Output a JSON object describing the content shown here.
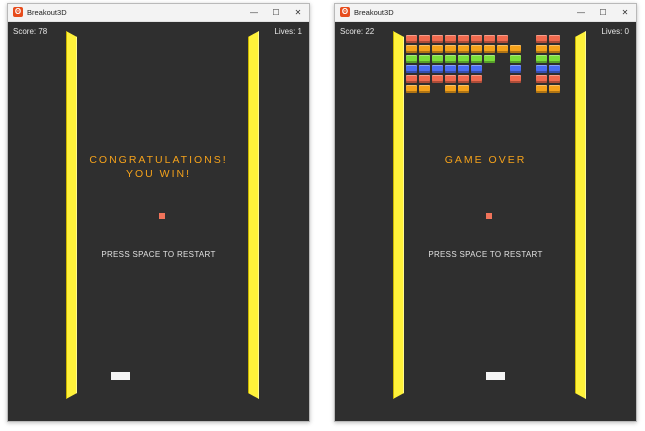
{
  "colors": {
    "wall": "#fff23a",
    "message": "#f5a21b",
    "ball": "#f0735a",
    "paddle": "#f5f5f5",
    "background": "#2f2f2f",
    "brick_rows": [
      "#f06a4e",
      "#f5a21b",
      "#7be03a",
      "#4a6df2",
      "#f06a4e",
      "#f5a21b"
    ]
  },
  "windows": [
    {
      "title": "Breakout3D",
      "score_label": "Score:",
      "score": "78",
      "lives_label": "Lives:",
      "lives": "1",
      "message_line1": "CONGRATULATIONS!",
      "message_line2": "YOU WIN!",
      "restart_text": "PRESS SPACE TO RESTART"
    },
    {
      "title": "Breakout3D",
      "score_label": "Score:",
      "score": "22",
      "lives_label": "Lives:",
      "lives": "0",
      "message_line1": "GAME OVER",
      "message_line2": "",
      "restart_text": "PRESS SPACE TO RESTART",
      "bricks": [
        [
          1,
          1,
          1,
          1,
          1,
          1,
          1,
          1,
          0,
          0,
          1,
          1
        ],
        [
          1,
          1,
          1,
          1,
          1,
          1,
          1,
          1,
          1,
          0,
          1,
          1
        ],
        [
          1,
          1,
          1,
          1,
          1,
          1,
          1,
          0,
          1,
          0,
          1,
          1
        ],
        [
          1,
          1,
          1,
          1,
          1,
          1,
          0,
          0,
          1,
          0,
          1,
          1
        ],
        [
          1,
          1,
          1,
          1,
          1,
          1,
          0,
          0,
          1,
          0,
          1,
          1
        ],
        [
          1,
          1,
          0,
          1,
          1,
          0,
          0,
          0,
          0,
          0,
          1,
          1
        ]
      ]
    }
  ]
}
